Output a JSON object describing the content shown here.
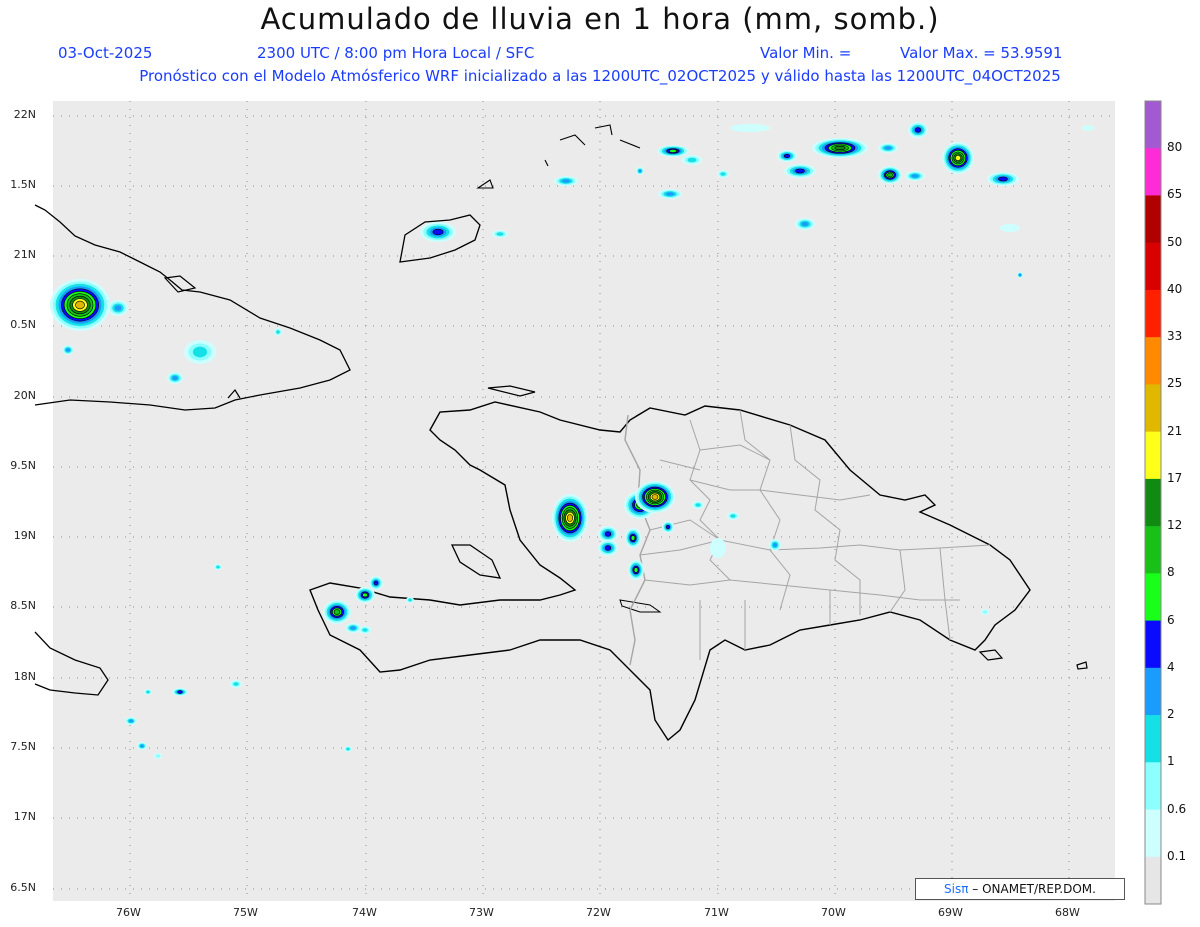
{
  "header": {
    "title": "Acumulado de lluvia en 1 hora (mm, somb.)",
    "date": "03-Oct-2025",
    "time": "2300 UTC / 8:00 pm Hora Local / SFC",
    "min_label": "Valor Min. =",
    "max_label": "Valor Max. = 53.9591",
    "model_line": "Pronóstico con el Modelo Atmósferico WRF inicializado a las 1200UTC_02OCT2025 y válido hasta las 1200UTC_04OCT2025"
  },
  "credit": {
    "brand": "Sisπ",
    "text": "– ONAMET/REP.DOM."
  },
  "axes": {
    "lat_labels": [
      "22N",
      "1.5N",
      "21N",
      "0.5N",
      "20N",
      "9.5N",
      "19N",
      "8.5N",
      "18N",
      "7.5N",
      "17N",
      "6.5N"
    ],
    "lon_labels": [
      "76W",
      "75W",
      "74W",
      "73W",
      "72W",
      "71W",
      "70W",
      "69W",
      "68W"
    ]
  },
  "colorbar": {
    "labels": [
      "80",
      "65",
      "50",
      "40",
      "33",
      "25",
      "21",
      "17",
      "12",
      "8",
      "6",
      "4",
      "2",
      "1",
      "0.6",
      "0.1"
    ],
    "colors": [
      "#a259d1",
      "#ff2bd6",
      "#b00000",
      "#d90000",
      "#ff2000",
      "#ff8a00",
      "#e0b800",
      "#ffff1a",
      "#118a11",
      "#18c018",
      "#1aff1a",
      "#0a0aff",
      "#1a9cff",
      "#14e0e6",
      "#8cffff",
      "#cdffff",
      "#e6e6e6"
    ]
  },
  "map": {
    "ocean_color": "#ebebeb",
    "coast_color": "#000000",
    "border_color": "#a5a5a5"
  }
}
